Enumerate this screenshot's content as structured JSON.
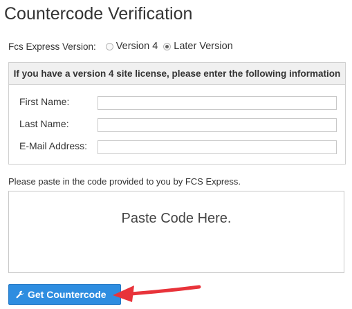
{
  "page": {
    "title": "Countercode Verification"
  },
  "version": {
    "label": "Fcs Express Version:",
    "options": [
      {
        "label": "Version 4",
        "checked": false
      },
      {
        "label": "Later Version",
        "checked": true
      }
    ]
  },
  "license_panel": {
    "heading": "If you have a version 4 site license, please enter the following information",
    "fields": [
      {
        "label": "First Name:",
        "value": ""
      },
      {
        "label": "Last Name:",
        "value": ""
      },
      {
        "label": "E-Mail Address:",
        "value": ""
      }
    ]
  },
  "paste": {
    "label": "Please paste in the code provided to you by FCS Express.",
    "placeholder": "Paste Code Here.",
    "value": ""
  },
  "submit": {
    "label": "Get Countercode",
    "icon": "wrench-icon"
  },
  "colors": {
    "button": "#2e8de0",
    "arrow": "#e8333a"
  }
}
